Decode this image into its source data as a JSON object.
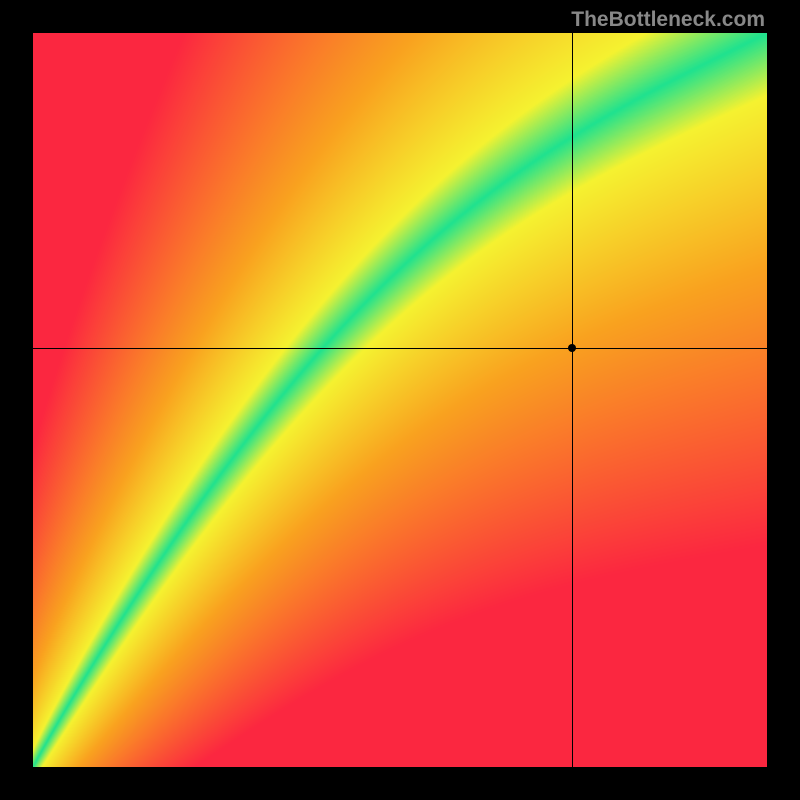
{
  "watermark": "TheBottleneck.com",
  "chart_data": {
    "type": "heatmap",
    "title": "",
    "xlabel": "",
    "ylabel": "",
    "xlim": [
      0,
      1
    ],
    "ylim": [
      0,
      1
    ],
    "marker": {
      "x": 0.735,
      "y": 0.571
    },
    "crosshair": {
      "x": 0.735,
      "y": 0.571
    },
    "optimal_curve_description": "Green diagonal band from bottom-left to top-right indicating optimal component pairing; red regions indicate bottleneck; gradient passes through yellow and orange between them.",
    "colors": {
      "optimal": "#1fe28f",
      "near": "#f5f230",
      "mid": "#f9a21f",
      "bottleneck": "#fb2740"
    }
  }
}
